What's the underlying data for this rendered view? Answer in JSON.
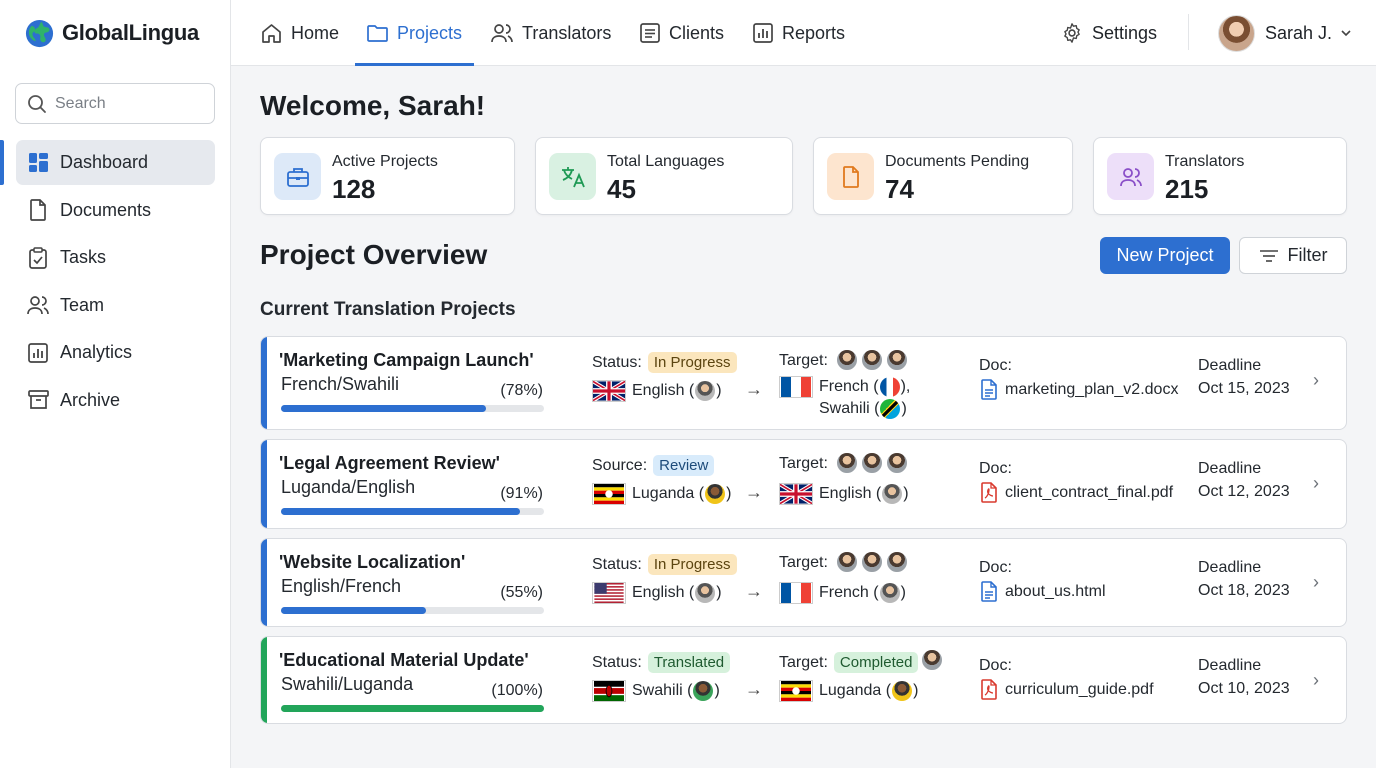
{
  "brand": {
    "name": "GlobalLingua"
  },
  "search": {
    "placeholder": "Search"
  },
  "sidebar": {
    "items": [
      {
        "label": "Dashboard",
        "icon": "dashboard-icon"
      },
      {
        "label": "Documents",
        "icon": "document-icon"
      },
      {
        "label": "Tasks",
        "icon": "clipboard-check-icon"
      },
      {
        "label": "Team",
        "icon": "team-icon"
      },
      {
        "label": "Analytics",
        "icon": "bar-chart-icon"
      },
      {
        "label": "Archive",
        "icon": "archive-icon"
      }
    ]
  },
  "topnav": {
    "tabs": [
      {
        "label": "Home",
        "icon": "home-icon"
      },
      {
        "label": "Projects",
        "icon": "folder-icon"
      },
      {
        "label": "Translators",
        "icon": "users-icon"
      },
      {
        "label": "Clients",
        "icon": "list-icon"
      },
      {
        "label": "Reports",
        "icon": "report-icon"
      }
    ],
    "settings": "Settings",
    "user": "Sarah J."
  },
  "welcome": "Welcome, Sarah!",
  "stats": [
    {
      "label": "Active Projects",
      "value": "128",
      "color": "#2d6fd0"
    },
    {
      "label": "Total Languages",
      "value": "45",
      "color": "#1f9a55"
    },
    {
      "label": "Documents Pending",
      "value": "74",
      "color": "#e07a1f"
    },
    {
      "label": "Translators",
      "value": "215",
      "color": "#8a4fc8"
    }
  ],
  "overview": {
    "title": "Project Overview",
    "new_button": "New Project",
    "filter_button": "Filter",
    "subtitle": "Current Translation Projects"
  },
  "projects": [
    {
      "name": "'Marketing Campaign Launch'",
      "langs": "French/Swahili",
      "pct": "(78%)",
      "progress": 0.78,
      "accent": "#2d6fd0",
      "state_label": "Status:",
      "badge": "In Progress",
      "source": "English (",
      "target_label": "Target:",
      "target_line1": "French (",
      "target_line1_tail": "),",
      "target_line2": "Swahili (",
      "target_line2_tail": ")",
      "doc_label": "Doc:",
      "doc": "marketing_plan_v2.docx",
      "deadline_label": "Deadline",
      "deadline": "Oct 15, 2023"
    },
    {
      "name": "'Legal Agreement Review'",
      "langs": "Luganda/English",
      "pct": "(91%)",
      "progress": 0.91,
      "accent": "#2d6fd0",
      "state_label": "Source:",
      "badge": "Review",
      "source": "Luganda (",
      "target_label": "Target:",
      "target_line1": "English (",
      "target_line1_tail": ")",
      "doc_label": "Doc:",
      "doc": "client_contract_final.pdf",
      "deadline_label": "Deadline",
      "deadline": "Oct 12, 2023"
    },
    {
      "name": "'Website Localization'",
      "langs": "English/French",
      "pct": "(55%)",
      "progress": 0.55,
      "accent": "#2d6fd0",
      "state_label": "Status:",
      "badge": "In Progress",
      "source": "English (",
      "target_label": "Target:",
      "target_line1": "French (",
      "target_line1_tail": ")",
      "doc_label": "Doc:",
      "doc": "about_us.html",
      "deadline_label": "Deadline",
      "deadline": "Oct 18, 2023"
    },
    {
      "name": "'Educational Material Update'",
      "langs": "Swahili/Luganda",
      "pct": "(100%)",
      "progress": 1.0,
      "accent": "#22a55a",
      "state_label": "Status:",
      "badge": "Translated",
      "source": "Swahili (",
      "target_label": "Target:",
      "target_badge": "Completed",
      "target_line1": "Luganda (",
      "target_line1_tail": ")",
      "doc_label": "Doc:",
      "doc": "curriculum_guide.pdf",
      "deadline_label": "Deadline",
      "deadline": "Oct 10, 2023"
    }
  ]
}
